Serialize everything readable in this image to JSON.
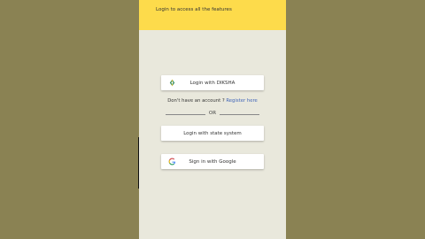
{
  "header": {
    "subtitle": "Login to access all the features"
  },
  "login": {
    "diksha_button": "Login with DIKSHA",
    "register_prompt": "Don't have an account ?",
    "register_link": "Register here",
    "or_label": "OR",
    "state_button": "Login with state system",
    "google_button": "Sign in with Google"
  },
  "icons": {
    "diksha": "diksha-logo-icon",
    "google": "google-g-icon"
  },
  "colors": {
    "background": "#8a8253",
    "header": "#fddb4b",
    "screen": "#e9e8dc",
    "link": "#3e63b8"
  }
}
